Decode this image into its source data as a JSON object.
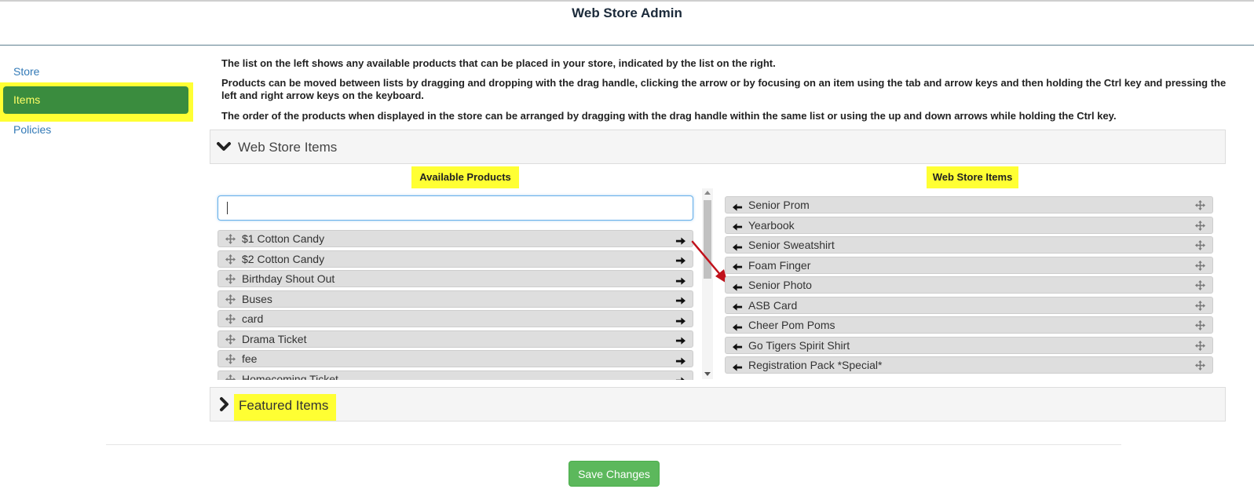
{
  "header": {
    "title": "Web Store Admin"
  },
  "sidebar": {
    "items": [
      {
        "label": "Store"
      },
      {
        "label": "Items",
        "active": true
      },
      {
        "label": "Policies"
      }
    ]
  },
  "instructions": [
    "The list on the left shows any available products that can be placed in your store, indicated by the list on the right.",
    "Products can be moved between lists by dragging and dropping with the drag handle, clicking the arrow or by focusing on an item using the tab and arrow keys and then holding the Ctrl key and pressing the left and right arrow keys on the keyboard.",
    "The order of the products when displayed in the store can be arranged by dragging with the drag handle within the same list or using the up and down arrows while holding the Ctrl key."
  ],
  "accordion": {
    "web_store_items": {
      "title": "Web Store Items",
      "expanded": true
    },
    "featured_items": {
      "title": "Featured Items",
      "expanded": false
    }
  },
  "available_products": {
    "title": "Available Products",
    "search_value": "",
    "items": [
      "$1 Cotton Candy",
      "$2 Cotton Candy",
      "Birthday Shout Out",
      "Buses",
      "card",
      "Drama Ticket",
      "fee",
      "Homecoming Ticket"
    ]
  },
  "web_store_items": {
    "title": "Web Store Items",
    "items": [
      "Senior Prom",
      "Yearbook",
      "Senior Sweatshirt",
      "Foam Finger",
      "Senior Photo",
      "ASB Card",
      "Cheer Pom Poms",
      "Go Tigers Spirit Shirt",
      "Registration Pack *Special*"
    ]
  },
  "footer": {
    "save_label": "Save Changes"
  },
  "colors": {
    "highlight": "#ffff33",
    "active_nav": "#3a8c3e",
    "save_button": "#5cb85c",
    "annotation_arrow": "#c0111b",
    "link": "#337ab7"
  },
  "icons": {
    "drag": "move-icon",
    "move_right": "arrow-right-icon",
    "move_left": "arrow-left-icon",
    "expand": "chevron-down-icon",
    "collapse": "chevron-right-icon"
  }
}
